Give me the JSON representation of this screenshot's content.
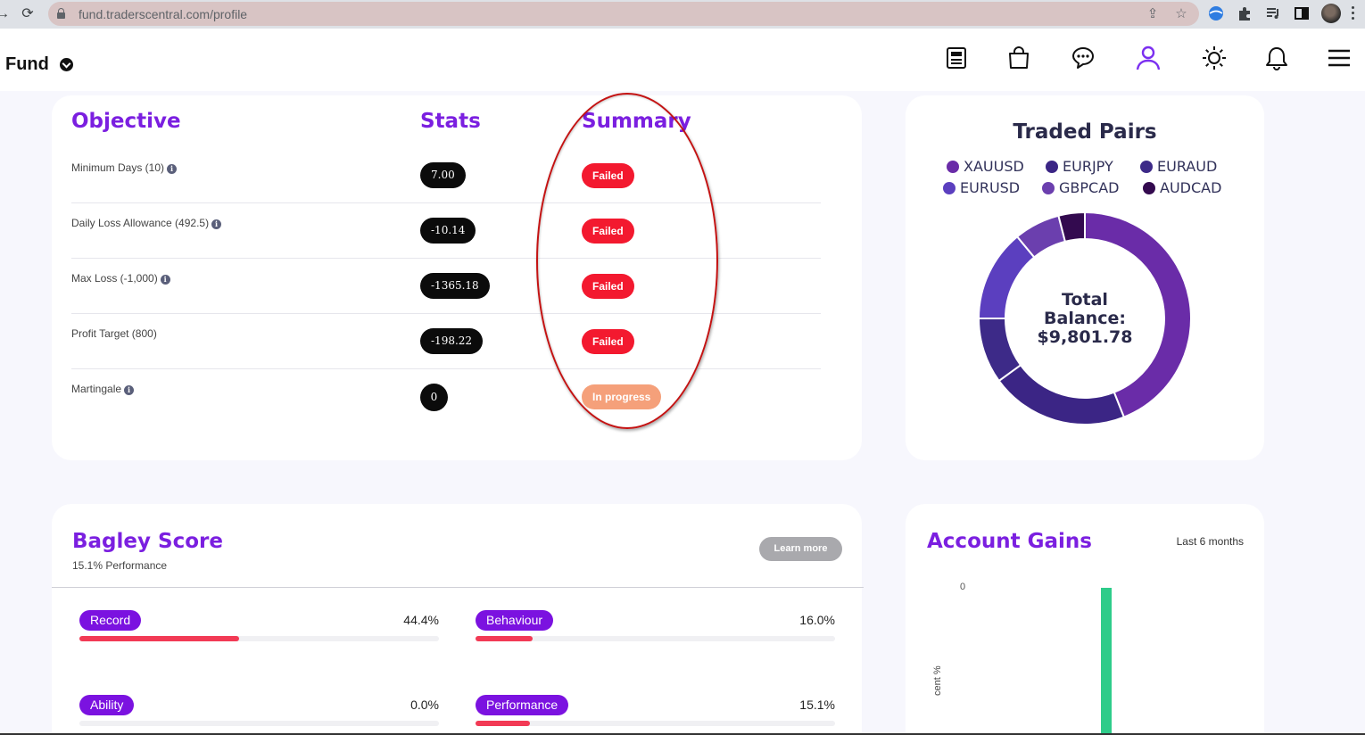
{
  "browser": {
    "url": "fund.traderscentral.com/profile"
  },
  "header": {
    "brand": "Fund",
    "icons": [
      "document-icon",
      "shopping-bag-icon",
      "chat-icon",
      "user-icon",
      "sun-icon",
      "bell-icon",
      "menu-icon"
    ],
    "accent": "#7b1fe0"
  },
  "objectives": {
    "headers": {
      "objective": "Objective",
      "stats": "Stats",
      "summary": "Summary"
    },
    "rows": [
      {
        "label": "Minimum Days (10)",
        "info": true,
        "stat": "7.00",
        "status": "Failed"
      },
      {
        "label": "Daily Loss Allowance (492.5)",
        "info": true,
        "stat": "-10.14",
        "status": "Failed"
      },
      {
        "label": "Max Loss (-1,000)",
        "info": true,
        "stat": "-1365.18",
        "status": "Failed"
      },
      {
        "label": "Profit Target (800)",
        "info": false,
        "stat": "-198.22",
        "status": "Failed"
      },
      {
        "label": "Martingale",
        "info": true,
        "stat": "0",
        "status": "In progress"
      }
    ],
    "status_colors": {
      "failed": "#f3192f",
      "in_progress": "#f5a07a"
    }
  },
  "traded_pairs": {
    "title": "Traded Pairs",
    "center_line1": "Total",
    "center_line2": "Balance:",
    "center_line3": "$9,801.78",
    "chart_data": {
      "type": "pie",
      "title": "Traded Pairs",
      "labels": [
        "XAUUSD",
        "EURJPY",
        "EURAUD",
        "EURUSD",
        "GBPCAD",
        "AUDCAD"
      ],
      "values": [
        44,
        21,
        10,
        14,
        7,
        4
      ],
      "colors": [
        "#6a2ca8",
        "#3b2585",
        "#3d2a88",
        "#5b3fbf",
        "#6b3fae",
        "#330a4f"
      ],
      "legend": "top"
    }
  },
  "bagley": {
    "title": "Bagley Score",
    "subtitle": "15.1% Performance",
    "learn_more": "Learn more",
    "metrics": [
      {
        "label": "Record",
        "value": "44.4%",
        "fraction": 0.444
      },
      {
        "label": "Behaviour",
        "value": "16.0%",
        "fraction": 0.16
      },
      {
        "label": "Ability",
        "value": "0.0%",
        "fraction": 0.0
      },
      {
        "label": "Performance",
        "value": "15.1%",
        "fraction": 0.151
      }
    ]
  },
  "account_gains": {
    "title": "Account Gains",
    "range": "Last 6 months",
    "zero_tick": "0",
    "ylabel": "cent %"
  }
}
